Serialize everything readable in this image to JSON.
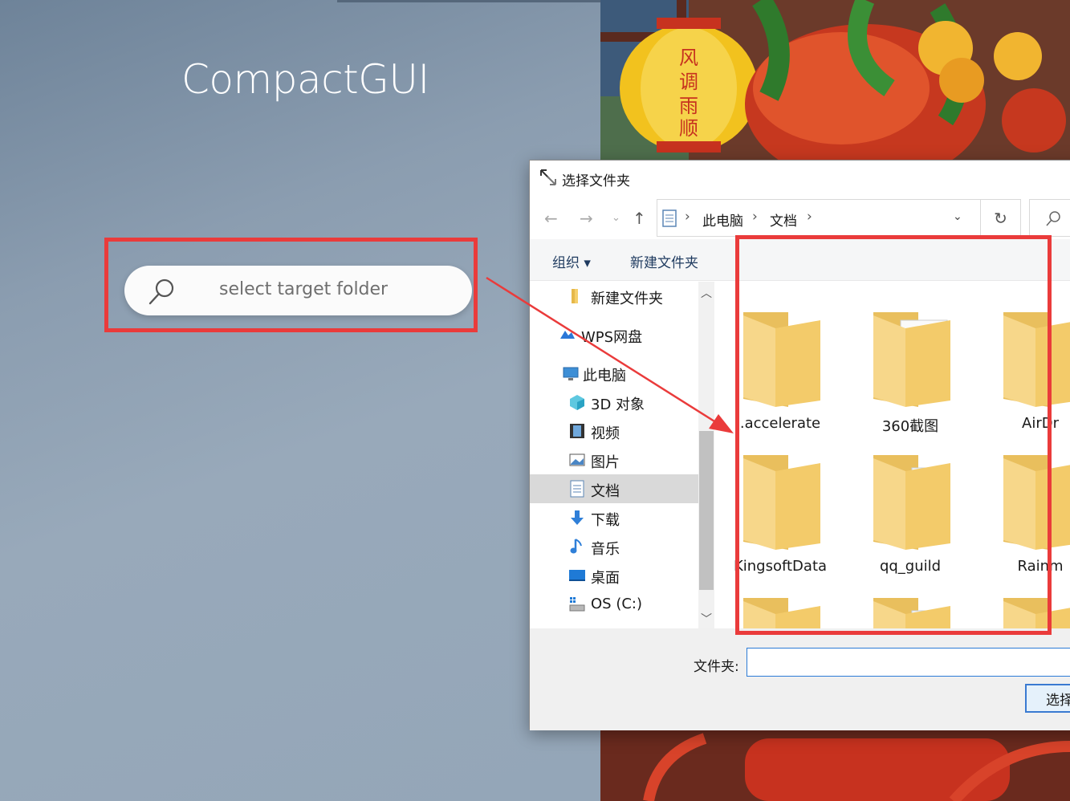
{
  "app": {
    "title": "CompactGUI",
    "search_placeholder": "select target folder"
  },
  "dialog": {
    "title": "选择文件夹",
    "breadcrumb": [
      "此电脑",
      "文档"
    ],
    "toolbar": {
      "organize": "组织 ▾",
      "new_folder": "新建文件夹"
    },
    "nav": [
      {
        "label": "新建文件夹",
        "icon": "folder-icon"
      },
      {
        "label": "WPS网盘",
        "icon": "cloud-icon"
      },
      {
        "label": "此电脑",
        "icon": "computer-icon"
      },
      {
        "label": "3D 对象",
        "icon": "cube-icon"
      },
      {
        "label": "视频",
        "icon": "video-icon"
      },
      {
        "label": "图片",
        "icon": "picture-icon"
      },
      {
        "label": "文档",
        "icon": "document-icon",
        "selected": true
      },
      {
        "label": "下载",
        "icon": "download-icon"
      },
      {
        "label": "音乐",
        "icon": "music-icon"
      },
      {
        "label": "桌面",
        "icon": "desktop-icon"
      },
      {
        "label": "OS (C:)",
        "icon": "drive-icon"
      }
    ],
    "files": [
      {
        "name": ".accelerate"
      },
      {
        "name": "360截图"
      },
      {
        "name": "AirDr"
      },
      {
        "name": "KingsoftData"
      },
      {
        "name": "qq_guild"
      },
      {
        "name": "Rainm"
      },
      {
        "name": ""
      },
      {
        "name": ""
      },
      {
        "name": ""
      }
    ],
    "folder_label": "文件夹:",
    "folder_value": "",
    "select_button": "选择"
  },
  "colors": {
    "highlight": "#ea3b3b",
    "accent": "#2c7bd6",
    "folder": "#f5cf6b"
  }
}
